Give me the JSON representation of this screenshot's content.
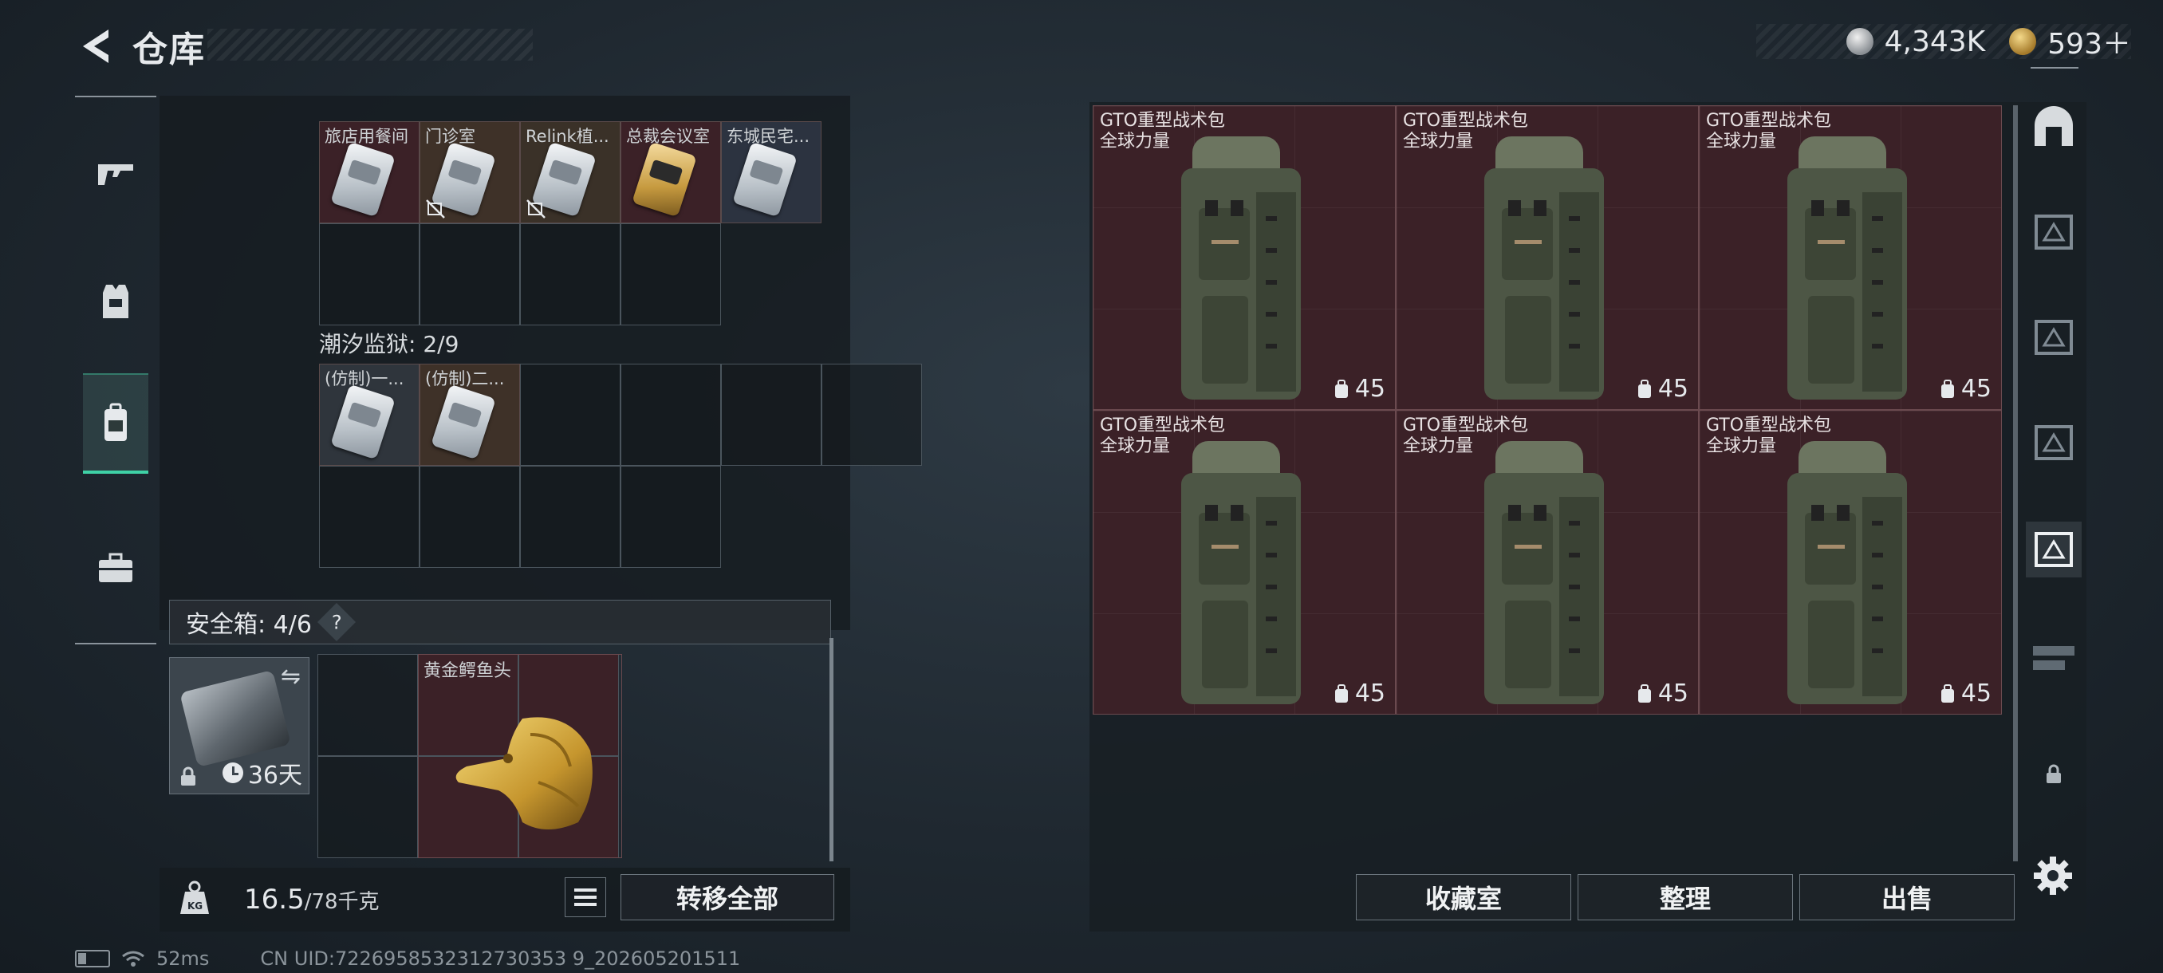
{
  "header": {
    "title": "仓库",
    "currency_1": "4,343K",
    "currency_2": "593＋"
  },
  "left_nav": [
    {
      "name": "weapon-tab",
      "icon": "rifle-icon"
    },
    {
      "name": "armor-tab",
      "icon": "vest-icon"
    },
    {
      "name": "backpack-tab",
      "icon": "backpack-icon",
      "active": true
    },
    {
      "name": "case-tab",
      "icon": "briefcase-icon"
    }
  ],
  "cards_row_1": [
    {
      "name": "旅店用餐间",
      "color": "red",
      "link_broken": false
    },
    {
      "name": "门诊室",
      "color": "red",
      "link_broken": true
    },
    {
      "name": "Relink植...",
      "color": "brown",
      "link_broken": true
    },
    {
      "name": "总裁会议室",
      "color": "red",
      "link_broken": false,
      "gold": true
    },
    {
      "name": "东城民宅...",
      "color": "blue",
      "link_broken": false
    }
  ],
  "tide_prison": {
    "label": "潮汐监狱: 2/9",
    "cards": [
      {
        "name": "(仿制)一...",
        "color": "gray"
      },
      {
        "name": "(仿制)二...",
        "color": "brown"
      }
    ]
  },
  "safe_box": {
    "label": "安全箱: 4/6",
    "help": "?",
    "timer": "36天",
    "item_name": "黄金鳄鱼头"
  },
  "weight": {
    "current": "16.5",
    "max": "/78千克"
  },
  "buttons": {
    "transfer_all": "转移全部",
    "collection": "收藏室",
    "organize": "整理",
    "sell": "出售"
  },
  "status": {
    "ping": "52ms",
    "uid": "CN UID:7226958532312730353 9_202605201511"
  },
  "bags": [
    {
      "name": "GTO重型战术包",
      "brand": "全球力量",
      "count": "45"
    },
    {
      "name": "GTO重型战术包",
      "brand": "全球力量",
      "count": "45"
    },
    {
      "name": "GTO重型战术包",
      "brand": "全球力量",
      "count": "45"
    },
    {
      "name": "GTO重型战术包",
      "brand": "全球力量",
      "count": "45"
    },
    {
      "name": "GTO重型战术包",
      "brand": "全球力量",
      "count": "45"
    },
    {
      "name": "GTO重型战术包",
      "brand": "全球力量",
      "count": "45"
    }
  ],
  "colors": {
    "accent": "#3fd1a6",
    "item_red": "#3b2127",
    "item_brown": "#3e3128",
    "item_blue": "#2c3340"
  }
}
